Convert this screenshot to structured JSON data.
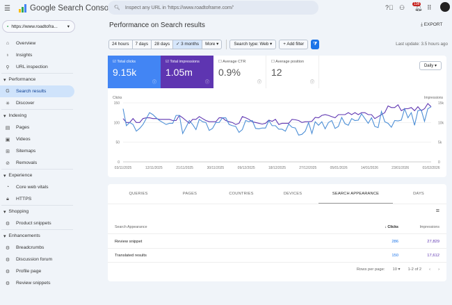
{
  "header": {
    "app_title": "Google Search Console",
    "search_placeholder": "Inspect any URL in 'https://www.roadtoframe.com/'",
    "notification_count": "138"
  },
  "sidebar": {
    "property": "https://www.roadtofra...",
    "top_items": [
      {
        "label": "Overview",
        "icon": "home-icon"
      },
      {
        "label": "Insights",
        "icon": "insights-icon"
      },
      {
        "label": "URL inspection",
        "icon": "search-icon"
      }
    ],
    "sections": [
      {
        "label": "Performance",
        "items": [
          {
            "label": "Search results",
            "icon": "google-icon",
            "active": true
          },
          {
            "label": "Discover",
            "icon": "discover-icon"
          }
        ]
      },
      {
        "label": "Indexing",
        "items": [
          {
            "label": "Pages",
            "icon": "pages-icon"
          },
          {
            "label": "Videos",
            "icon": "videos-icon"
          },
          {
            "label": "Sitemaps",
            "icon": "sitemaps-icon"
          },
          {
            "label": "Removals",
            "icon": "removals-icon"
          }
        ]
      },
      {
        "label": "Experience",
        "items": [
          {
            "label": "Core web vitals",
            "icon": "gauge-icon"
          },
          {
            "label": "HTTPS",
            "icon": "lock-icon"
          }
        ]
      },
      {
        "label": "Shopping",
        "items": [
          {
            "label": "Product snippets",
            "icon": "diamond-icon"
          }
        ]
      },
      {
        "label": "Enhancements",
        "items": [
          {
            "label": "Breadcrumbs",
            "icon": "diamond-icon"
          },
          {
            "label": "Discussion forum",
            "icon": "diamond-icon"
          },
          {
            "label": "Profile page",
            "icon": "diamond-icon"
          },
          {
            "label": "Review snippets",
            "icon": "diamond-icon"
          }
        ]
      }
    ]
  },
  "main": {
    "title": "Performance on Search results",
    "export": "EXPORT",
    "ranges": [
      "24 hours",
      "7 days",
      "28 days",
      "3 months",
      "More"
    ],
    "selected_range": "3 months",
    "search_type": "Search type: Web",
    "add_filter": "Add filter",
    "last_update": "Last update: 3.5 hours ago",
    "metrics": [
      {
        "label": "Total clicks",
        "value": "9.15k",
        "checked": true,
        "color": "#4285f4"
      },
      {
        "label": "Total impressions",
        "value": "1.05m",
        "checked": true,
        "color": "#5e35b1"
      },
      {
        "label": "Average CTR",
        "value": "0.9%",
        "checked": false
      },
      {
        "label": "Average position",
        "value": "12",
        "checked": false
      }
    ],
    "granularity": "Daily"
  },
  "chart_data": {
    "type": "line",
    "left_axis_label": "Clicks",
    "right_axis_label": "Impressions",
    "left_ylim": [
      0,
      150
    ],
    "right_ylim": [
      0,
      15000
    ],
    "left_ticks": [
      "0",
      "50",
      "100",
      "150"
    ],
    "right_ticks": [
      "0",
      "5k",
      "10k",
      "15k"
    ],
    "x_tick_labels": [
      "03/11/2025",
      "12/11/2025",
      "21/11/2025",
      "30/11/2025",
      "09/12/2025",
      "18/12/2025",
      "27/12/2025",
      "05/01/2026",
      "14/01/2026",
      "23/01/2026",
      "01/02/2026"
    ],
    "grid": true,
    "series": [
      {
        "name": "Clicks",
        "color": "#4d8fd6",
        "axis": "left",
        "values": [
          135,
          92,
          100,
          95,
          78,
          85,
          95,
          110,
          125,
          120,
          112,
          105,
          100,
          95,
          98,
          98,
          118,
          118,
          72,
          88,
          105,
          95,
          82,
          108,
          102,
          100,
          80,
          85,
          100,
          100,
          112,
          112,
          95,
          92,
          90,
          75,
          82,
          105,
          102,
          105,
          85,
          84,
          86,
          86,
          105,
          92,
          92,
          83,
          83,
          78,
          96,
          88,
          86,
          68,
          70,
          78,
          100,
          72,
          102,
          93,
          102,
          84,
          100,
          105,
          85,
          90,
          113,
          97,
          93,
          110,
          105,
          106,
          122,
          110,
          98,
          112,
          90,
          87,
          128,
          102,
          98,
          88,
          105,
          104,
          106,
          135,
          112,
          125,
          93,
          130,
          132,
          103,
          135,
          140
        ]
      },
      {
        "name": "Impressions",
        "color": "#5e35b1",
        "axis": "right",
        "values": [
          11000,
          10000,
          10000,
          11000,
          10000,
          10000,
          11000,
          11200,
          11200,
          11000,
          11000,
          10800,
          10800,
          10800,
          10800,
          10500,
          10500,
          11800,
          11200,
          10500,
          9800,
          10800,
          10800,
          11500,
          11000,
          10500,
          10200,
          10200,
          10200,
          11200,
          11200,
          10500,
          10200,
          10000,
          9500,
          9800,
          11500,
          11200,
          10800,
          10200,
          10000,
          9800,
          9600,
          9800,
          10600,
          10300,
          10800,
          9500,
          9800,
          9800,
          9800,
          10800,
          10700,
          10500,
          10000,
          10200,
          10200,
          10300,
          11300,
          11200,
          11800,
          12000,
          11800,
          11500,
          11200,
          12000,
          12000,
          12000,
          12500,
          12000,
          12500,
          12000,
          12500,
          12500,
          12000,
          12000,
          11000,
          11500,
          12000,
          12500,
          14200,
          13800,
          13800,
          14500,
          13000,
          13500,
          13500,
          13800,
          13000,
          14000,
          13000,
          13500,
          14800,
          14000
        ]
      }
    ]
  },
  "table": {
    "tabs": [
      "QUERIES",
      "PAGES",
      "COUNTRIES",
      "DEVICES",
      "SEARCH APPEARANCE",
      "DAYS"
    ],
    "active_tab": "SEARCH APPEARANCE",
    "columns": [
      "Search Appearance",
      "Clicks",
      "Impressions"
    ],
    "rows": [
      {
        "name": "Review snippet",
        "clicks": "286",
        "impressions": "27,829"
      },
      {
        "name": "Translated results",
        "clicks": "150",
        "impressions": "17,612"
      }
    ],
    "rows_per_page_label": "Rows per page:",
    "rows_per_page": "10",
    "range": "1-2 of 2"
  }
}
